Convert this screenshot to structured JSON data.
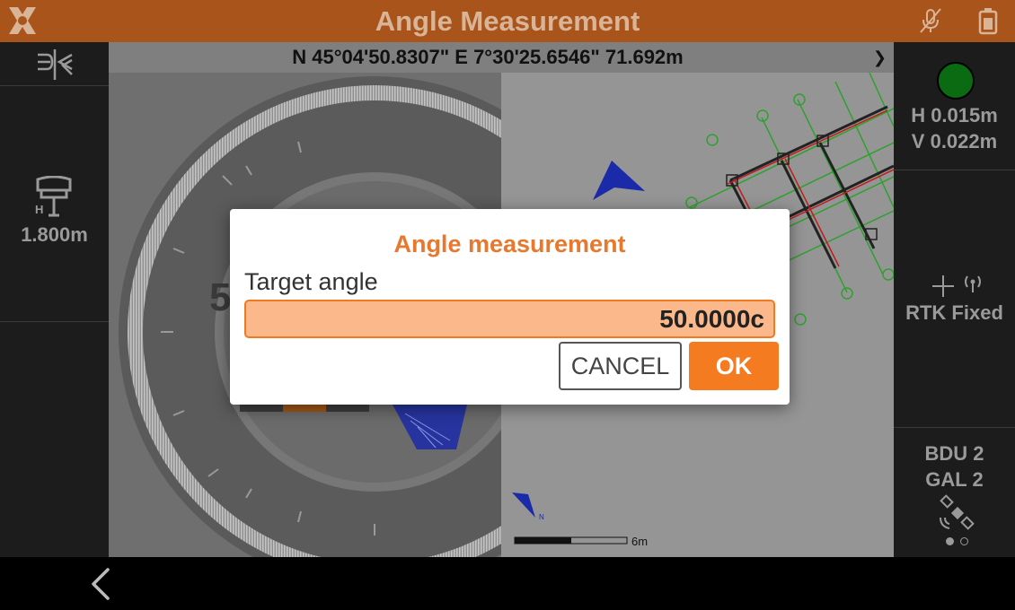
{
  "app": {
    "title": "Angle Measurement"
  },
  "coordinates": {
    "text": "N 45°04'50.8307\" E 7°30'25.6546\" 71.692m"
  },
  "left_panel": {
    "antenna_height": "1.800m",
    "antenna_height_prefix": "H"
  },
  "right_panel": {
    "h_precision": "H 0.015m",
    "v_precision": "V 0.022m",
    "fix_status": "RTK Fixed",
    "bdu_satellites": "BDU 2",
    "gal_satellites": "GAL 2"
  },
  "map": {
    "scale_label": "6m",
    "north_label": "N"
  },
  "dialog": {
    "title": "Angle measurement",
    "field_label": "Target angle",
    "target_angle_value": "50.0000c",
    "cancel_label": "CANCEL",
    "ok_label": "OK"
  },
  "colors": {
    "accent": "#f47b20",
    "title_bar": "#a9541b",
    "fix_indicator": "#0a6b12",
    "input_fill": "#fbb98b"
  },
  "icons": {
    "logo": "app-logo-icon",
    "mic": "mic-muted-icon",
    "battery": "battery-icon",
    "toolbar": "stakeout-mode-icon",
    "antenna": "gnss-antenna-icon",
    "crosshair": "crosshair-icon",
    "radio": "radio-signal-icon",
    "satellite": "satellite-icon",
    "back": "back-chevron-icon"
  }
}
